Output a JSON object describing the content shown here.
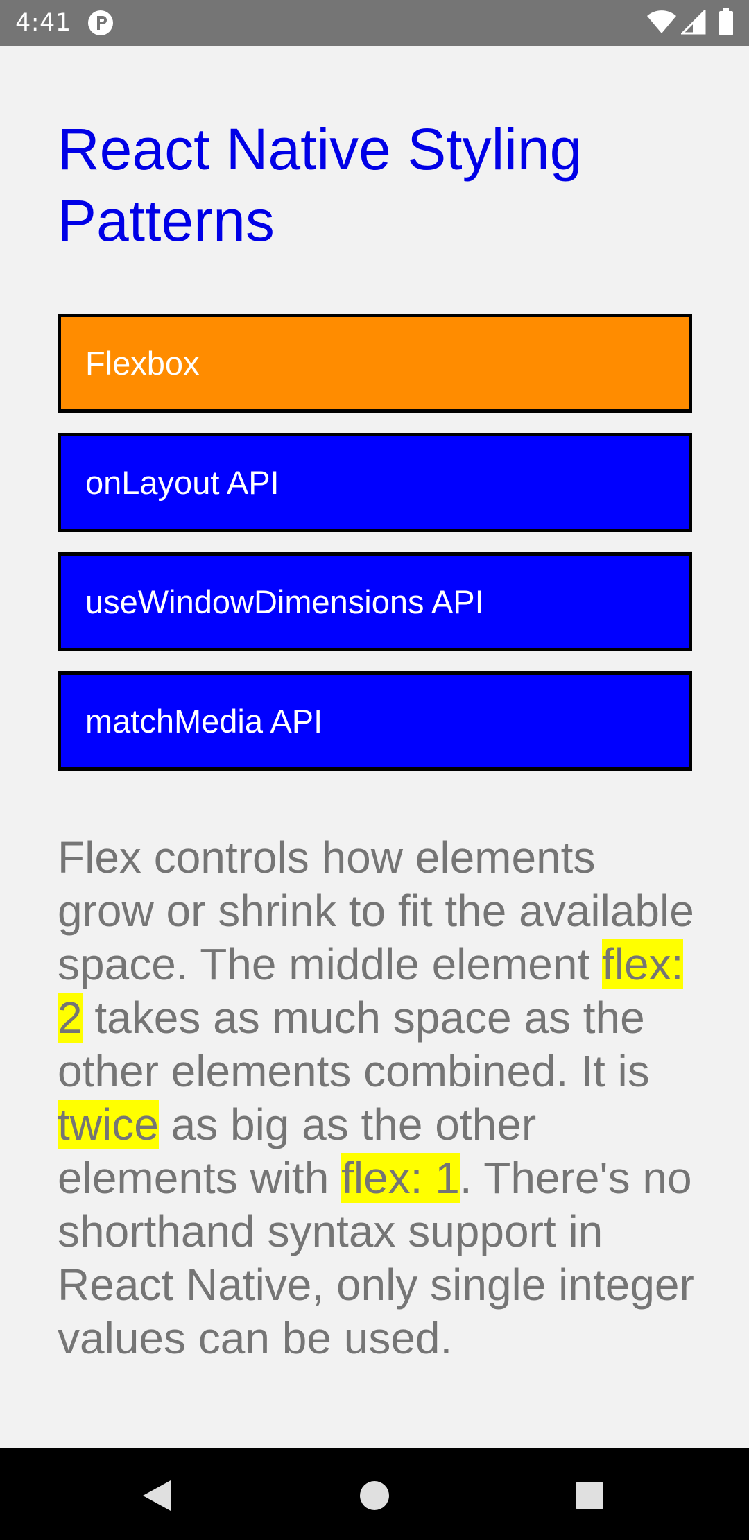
{
  "status_bar": {
    "time": "4:41",
    "icons": [
      "app-notification-icon",
      "wifi-icon",
      "signal-icon",
      "battery-icon"
    ]
  },
  "header": {
    "title": "React Native Styling Patterns"
  },
  "menu": {
    "items": [
      {
        "label": "Flexbox",
        "active": true
      },
      {
        "label": "onLayout API",
        "active": false
      },
      {
        "label": "useWindowDimensions API",
        "active": false
      },
      {
        "label": "matchMedia API",
        "active": false
      }
    ]
  },
  "description": {
    "part1": "Flex controls how elements grow or shrink to fit the available space. The middle element ",
    "highlight1": "flex: 2",
    "part2": " takes as much space as the other elements combined. It is ",
    "highlight2": "twice",
    "part3": " as big as the other elements with ",
    "highlight3": "flex: 1",
    "part4": ". There's no shorthand syntax support in React Native, only single integer values can be used."
  },
  "nav_bar": {
    "icons": [
      "back-icon",
      "home-icon",
      "recents-icon"
    ]
  },
  "colors": {
    "status_bar": "#757575",
    "background": "#f2f2f2",
    "title": "#0000e6",
    "button_default": "#0000ff",
    "button_active": "#ff8c00",
    "button_border": "#000000",
    "description_text": "#757575",
    "highlight": "#ffff00",
    "nav_bar": "#000000"
  }
}
